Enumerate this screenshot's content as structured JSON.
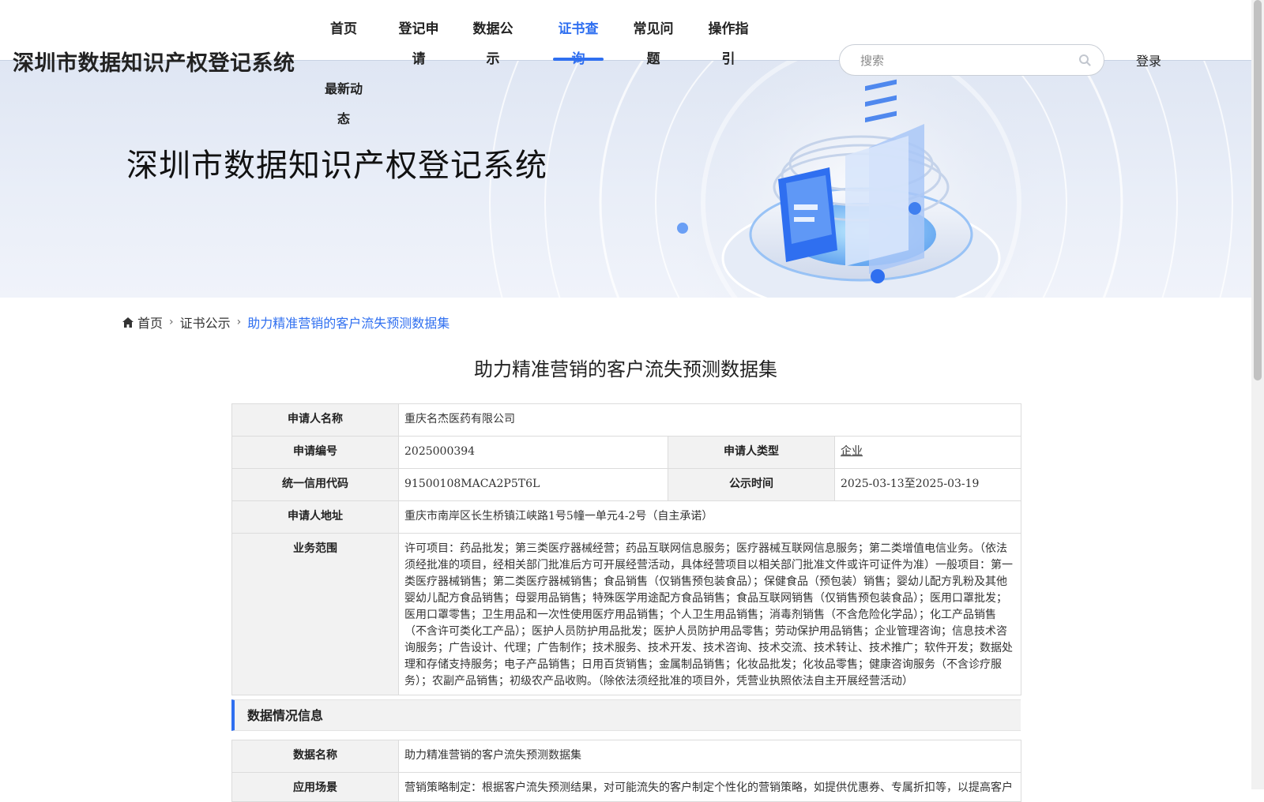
{
  "header": {
    "logo": "深圳市数据知识产权登记系统",
    "nav": [
      {
        "label": "首页"
      },
      {
        "label": "登记申请"
      },
      {
        "label": "数据公示"
      },
      {
        "label": "证书查询",
        "active": true
      },
      {
        "label": "常见问题"
      },
      {
        "label": "操作指引"
      },
      {
        "label": "最新动态"
      }
    ],
    "search_placeholder": "搜索",
    "login": "登录",
    "accent_color": "#2f6ff0"
  },
  "banner": {
    "title": "深圳市数据知识产权登记系统"
  },
  "breadcrumb": {
    "home_icon": "home-icon",
    "items": [
      "首页",
      "证书公示",
      "助力精准营销的客户流失预测数据集"
    ]
  },
  "page_title": "助力精准营销的客户流失预测数据集",
  "applicant": {
    "name_label": "申请人名称",
    "name": "重庆名杰医药有限公司",
    "number_label": "申请编号",
    "number": "2025000394",
    "type_label": "申请人类型",
    "type": "企业",
    "credit_code_label": "统一信用代码",
    "credit_code": "91500108MACA2P5T6L",
    "publicity_label": "公示时间",
    "publicity_period": "2025-03-13至2025-03-19",
    "address_label": "申请人地址",
    "address": "重庆市南岸区长生桥镇江峡路1号5幢一单元4-2号（自主承诺）",
    "scope_label": "业务范围",
    "scope": "许可项目：药品批发；第三类医疗器械经营；药品互联网信息服务；医疗器械互联网信息服务；第二类增值电信业务。（依法须经批准的项目，经相关部门批准后方可开展经营活动，具体经营项目以相关部门批准文件或许可证件为准）一般项目：第一类医疗器械销售；第二类医疗器械销售；食品销售（仅销售预包装食品）；保健食品（预包装）销售；婴幼儿配方乳粉及其他婴幼儿配方食品销售；母婴用品销售；特殊医学用途配方食品销售；食品互联网销售（仅销售预包装食品）；医用口罩批发；医用口罩零售；卫生用品和一次性使用医疗用品销售；个人卫生用品销售；消毒剂销售（不含危险化学品）；化工产品销售（不含许可类化工产品）；医护人员防护用品批发；医护人员防护用品零售；劳动保护用品销售；企业管理咨询；信息技术咨询服务；广告设计、代理；广告制作；技术服务、技术开发、技术咨询、技术交流、技术转让、技术推广；软件开发；数据处理和存储支持服务；电子产品销售；日用百货销售；金属制品销售；化妆品批发；化妆品零售；健康咨询服务（不含诊疗服务）；农副产品销售；初级农产品收购。（除依法须经批准的项目外，凭营业执照依法自主开展经营活动）"
  },
  "data_section": {
    "title": "数据情况信息",
    "data_name_label": "数据名称",
    "data_name": "助力精准营销的客户流失预测数据集",
    "scenario_label": "应用场景",
    "scenario": "营销策略制定：根据客户流失预测结果，对可能流失的客户制定个性化的营销策略，如提供优惠券、专属折扣等，以提高客户"
  }
}
